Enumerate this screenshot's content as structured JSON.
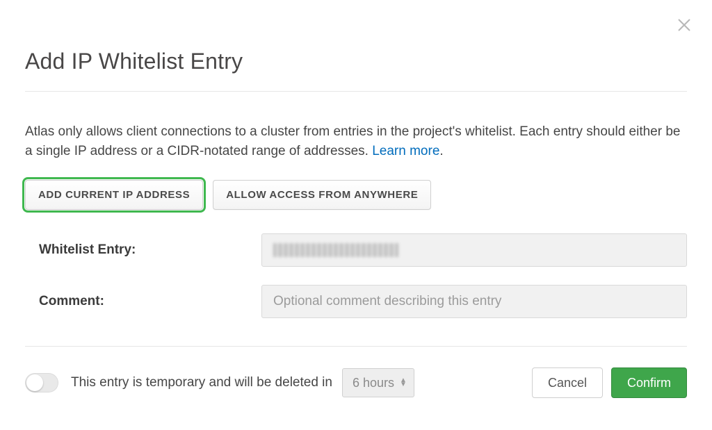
{
  "title": "Add IP Whitelist Entry",
  "description": "Atlas only allows client connections to a cluster from entries in the project's whitelist. Each entry should either be a single IP address or a CIDR-notated range of addresses. ",
  "learn_more": "Learn more",
  "buttons": {
    "add_current_ip": "ADD CURRENT IP ADDRESS",
    "allow_anywhere": "ALLOW ACCESS FROM ANYWHERE"
  },
  "form": {
    "whitelist_label": "Whitelist Entry:",
    "whitelist_value": "",
    "comment_label": "Comment:",
    "comment_placeholder": "Optional comment describing this entry",
    "comment_value": ""
  },
  "footer": {
    "temporary_text": "This entry is temporary and will be deleted in",
    "duration_selected": "6 hours",
    "cancel": "Cancel",
    "confirm": "Confirm",
    "toggle_on": false
  }
}
